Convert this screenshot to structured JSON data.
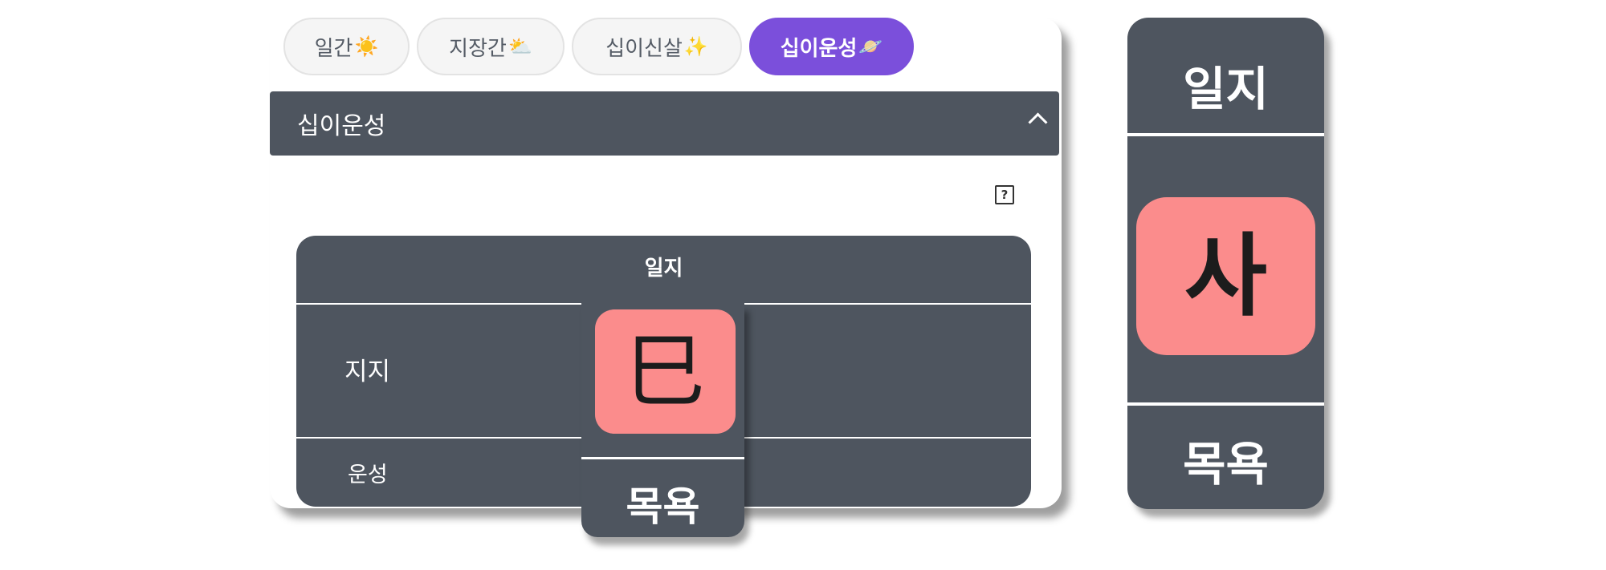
{
  "tabs": [
    {
      "label": "일간",
      "emoji": "☀️"
    },
    {
      "label": "지장간",
      "emoji": "⛅"
    },
    {
      "label": "십이신살",
      "emoji": "✨"
    },
    {
      "label": "십이운성",
      "emoji": "🪐",
      "active": true
    }
  ],
  "section": {
    "title": "십이운성",
    "expanded": true
  },
  "help": {
    "symbol": "?"
  },
  "table": {
    "column_header": "일지",
    "row_labels": {
      "jiji": "지지",
      "unseong": "운성"
    },
    "cell": {
      "branch": "巳",
      "unseong": "목욕"
    }
  },
  "side_panel": {
    "title": "일지",
    "branch": "사",
    "unseong": "목욕"
  },
  "colors": {
    "accent": "#7b4fdb",
    "panel": "#4e555f",
    "branch_highlight": "#fb8c8c"
  }
}
